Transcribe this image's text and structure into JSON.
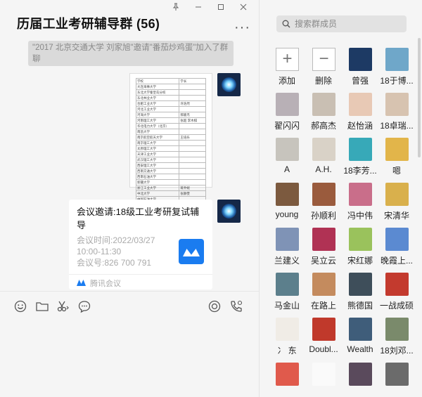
{
  "chat": {
    "title": "历届工业考研辅导群 (56)",
    "more_label": "···",
    "system_message": "\"2017 北京交通大学 刘家旭\"邀请\"番茄炒鸡蛋\"加入了群聊",
    "image_table_rows": [
      [
        "学校",
        "学长"
      ],
      [
        "大连海事大学",
        ""
      ],
      [
        "东北大学秦皇岛分校",
        ""
      ],
      [
        "东北林业大学",
        ""
      ],
      [
        "合肥工业大学",
        "许浩然"
      ],
      [
        "河北工业大学",
        ""
      ],
      [
        "河海大学",
        "郝嘉杰"
      ],
      [
        "河南理工大学",
        "张超 李木棋"
      ],
      [
        "华北电力大学（北京）",
        ""
      ],
      [
        "南昌大学",
        ""
      ],
      [
        "南京航空航天大学",
        "王培乐"
      ],
      [
        "南京理工大学",
        ""
      ],
      [
        "太原理工大学",
        ""
      ],
      [
        "天津工业大学",
        ""
      ],
      [
        "武汉理工大学",
        ""
      ],
      [
        "西安理工大学",
        ""
      ],
      [
        "西南交通大学",
        ""
      ],
      [
        "西南石油大学",
        ""
      ],
      [
        "新疆大学",
        ""
      ],
      [
        "浙江工业大学",
        "蒋乔妮"
      ],
      [
        "中北大学",
        "张静雯"
      ],
      [
        "中国石油大学",
        ""
      ]
    ],
    "card": {
      "title": "会议邀请:18级工业考研复试辅导",
      "time_line1": "会议时间:2022/03/27",
      "time_line2": "10:00-11:30",
      "number_line": "会议号:826 700 791",
      "source": "腾讯会议",
      "logo_color": "#1a7cf0"
    }
  },
  "window_controls": [
    "pin",
    "minimize",
    "maximize",
    "close"
  ],
  "toolbar": [
    "emoji-icon",
    "folder-icon",
    "scissors-icon",
    "chat-bubble-icon",
    "live-icon",
    "voice-call-icon"
  ],
  "members_panel": {
    "search_placeholder": "搜索群成员",
    "add_label": "添加",
    "remove_label": "删除",
    "members": [
      {
        "name": "曾强",
        "color": "#1d3a64"
      },
      {
        "name": "18于博...",
        "color": "#6fa7c9"
      },
      {
        "name": "翟闪闪",
        "color": "#b8b0b6"
      },
      {
        "name": "郝高杰",
        "color": "#c9bfb3"
      },
      {
        "name": "赵怡涵",
        "color": "#e8c9b5"
      },
      {
        "name": "18卓瑞...",
        "color": "#d7c3b0"
      },
      {
        "name": "A",
        "color": "#c7c4bd"
      },
      {
        "name": "A.H.",
        "color": "#d9d2c7"
      },
      {
        "name": "18李芳...",
        "color": "#37a9b8"
      },
      {
        "name": "嗯",
        "color": "#e2b54a"
      },
      {
        "name": "young",
        "color": "#7c5a3f"
      },
      {
        "name": "孙顺利",
        "color": "#9a5b3d"
      },
      {
        "name": "冯中伟",
        "color": "#c96e8a"
      },
      {
        "name": "宋清华",
        "color": "#d9b04c"
      },
      {
        "name": "兰建义",
        "color": "#7f93b6"
      },
      {
        "name": "吴立云",
        "color": "#b03254"
      },
      {
        "name": "宋红娜",
        "color": "#9ac25c"
      },
      {
        "name": "晚霞上...",
        "color": "#5b8ad1"
      },
      {
        "name": "马金山",
        "color": "#5c7f8c"
      },
      {
        "name": "在路上",
        "color": "#c48b5e"
      },
      {
        "name": "熊德国",
        "color": "#3e4e5a"
      },
      {
        "name": "一战成硕",
        "color": "#c33a2e"
      },
      {
        "name": "冫 东",
        "color": "#f0ece6"
      },
      {
        "name": "Doubl...",
        "color": "#c0392b"
      },
      {
        "name": "Wealth",
        "color": "#3f5d7a"
      },
      {
        "name": "18刘邓...",
        "color": "#7a8a6b"
      },
      {
        "name": "",
        "color": "#e05a4c"
      },
      {
        "name": "",
        "color": "#fafafa"
      },
      {
        "name": "",
        "color": "#5a4a5c"
      },
      {
        "name": "",
        "color": "#6b6b6b"
      }
    ]
  }
}
